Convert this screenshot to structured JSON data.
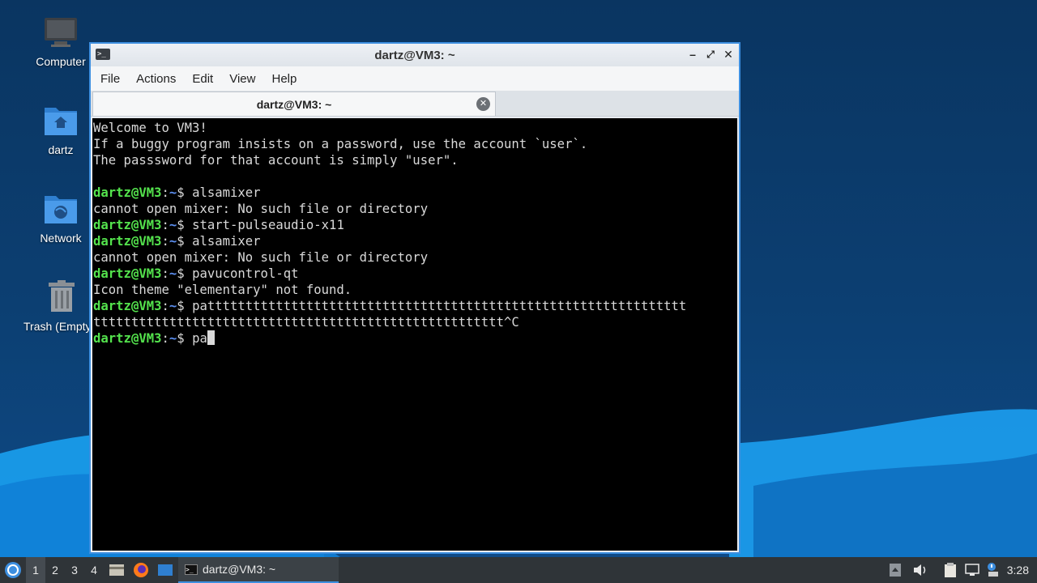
{
  "desktop": {
    "icons": [
      {
        "label": "Computer",
        "icon": "computer-icon"
      },
      {
        "label": "dartz",
        "icon": "home-folder-icon"
      },
      {
        "label": "Network",
        "icon": "network-folder-icon"
      },
      {
        "label": "Trash (Empty)",
        "icon": "trash-icon"
      }
    ]
  },
  "window": {
    "title": "dartz@VM3: ~",
    "menu": [
      "File",
      "Actions",
      "Edit",
      "View",
      "Help"
    ],
    "tab_label": "dartz@VM3: ~"
  },
  "terminal": {
    "prompt_user": "dartz@VM3",
    "prompt_sep": ":",
    "prompt_path": "~",
    "prompt_end": "$ ",
    "lines": [
      {
        "type": "text",
        "text": "Welcome to VM3!"
      },
      {
        "type": "text",
        "text": "If a buggy program insists on a password, use the account `user`."
      },
      {
        "type": "text",
        "text": "The passsword for that account is simply \"user\"."
      },
      {
        "type": "text",
        "text": ""
      },
      {
        "type": "cmd",
        "text": "alsamixer"
      },
      {
        "type": "text",
        "text": "cannot open mixer: No such file or directory"
      },
      {
        "type": "cmd",
        "text": "start-pulseaudio-x11"
      },
      {
        "type": "cmd",
        "text": "alsamixer"
      },
      {
        "type": "text",
        "text": "cannot open mixer: No such file or directory"
      },
      {
        "type": "cmd",
        "text": "pavucontrol-qt"
      },
      {
        "type": "text",
        "text": "Icon theme \"elementary\" not found."
      },
      {
        "type": "cmd",
        "text": "pattttttttttttttttttttttttttttttttttttttttttttttttttttttttttttttt"
      },
      {
        "type": "text",
        "text": "tttttttttttttttttttttttttttttttttttttttttttttttttttttt^C"
      },
      {
        "type": "cmd_cursor",
        "text": "pa"
      }
    ]
  },
  "taskbar": {
    "workspaces": [
      "1",
      "2",
      "3",
      "4"
    ],
    "active_workspace": "1",
    "task_label": "dartz@VM3: ~",
    "clock": "3:28"
  },
  "colors": {
    "prompt_user": "#54e34d",
    "prompt_path": "#5c8ff0",
    "accent": "#3d8fe0"
  }
}
